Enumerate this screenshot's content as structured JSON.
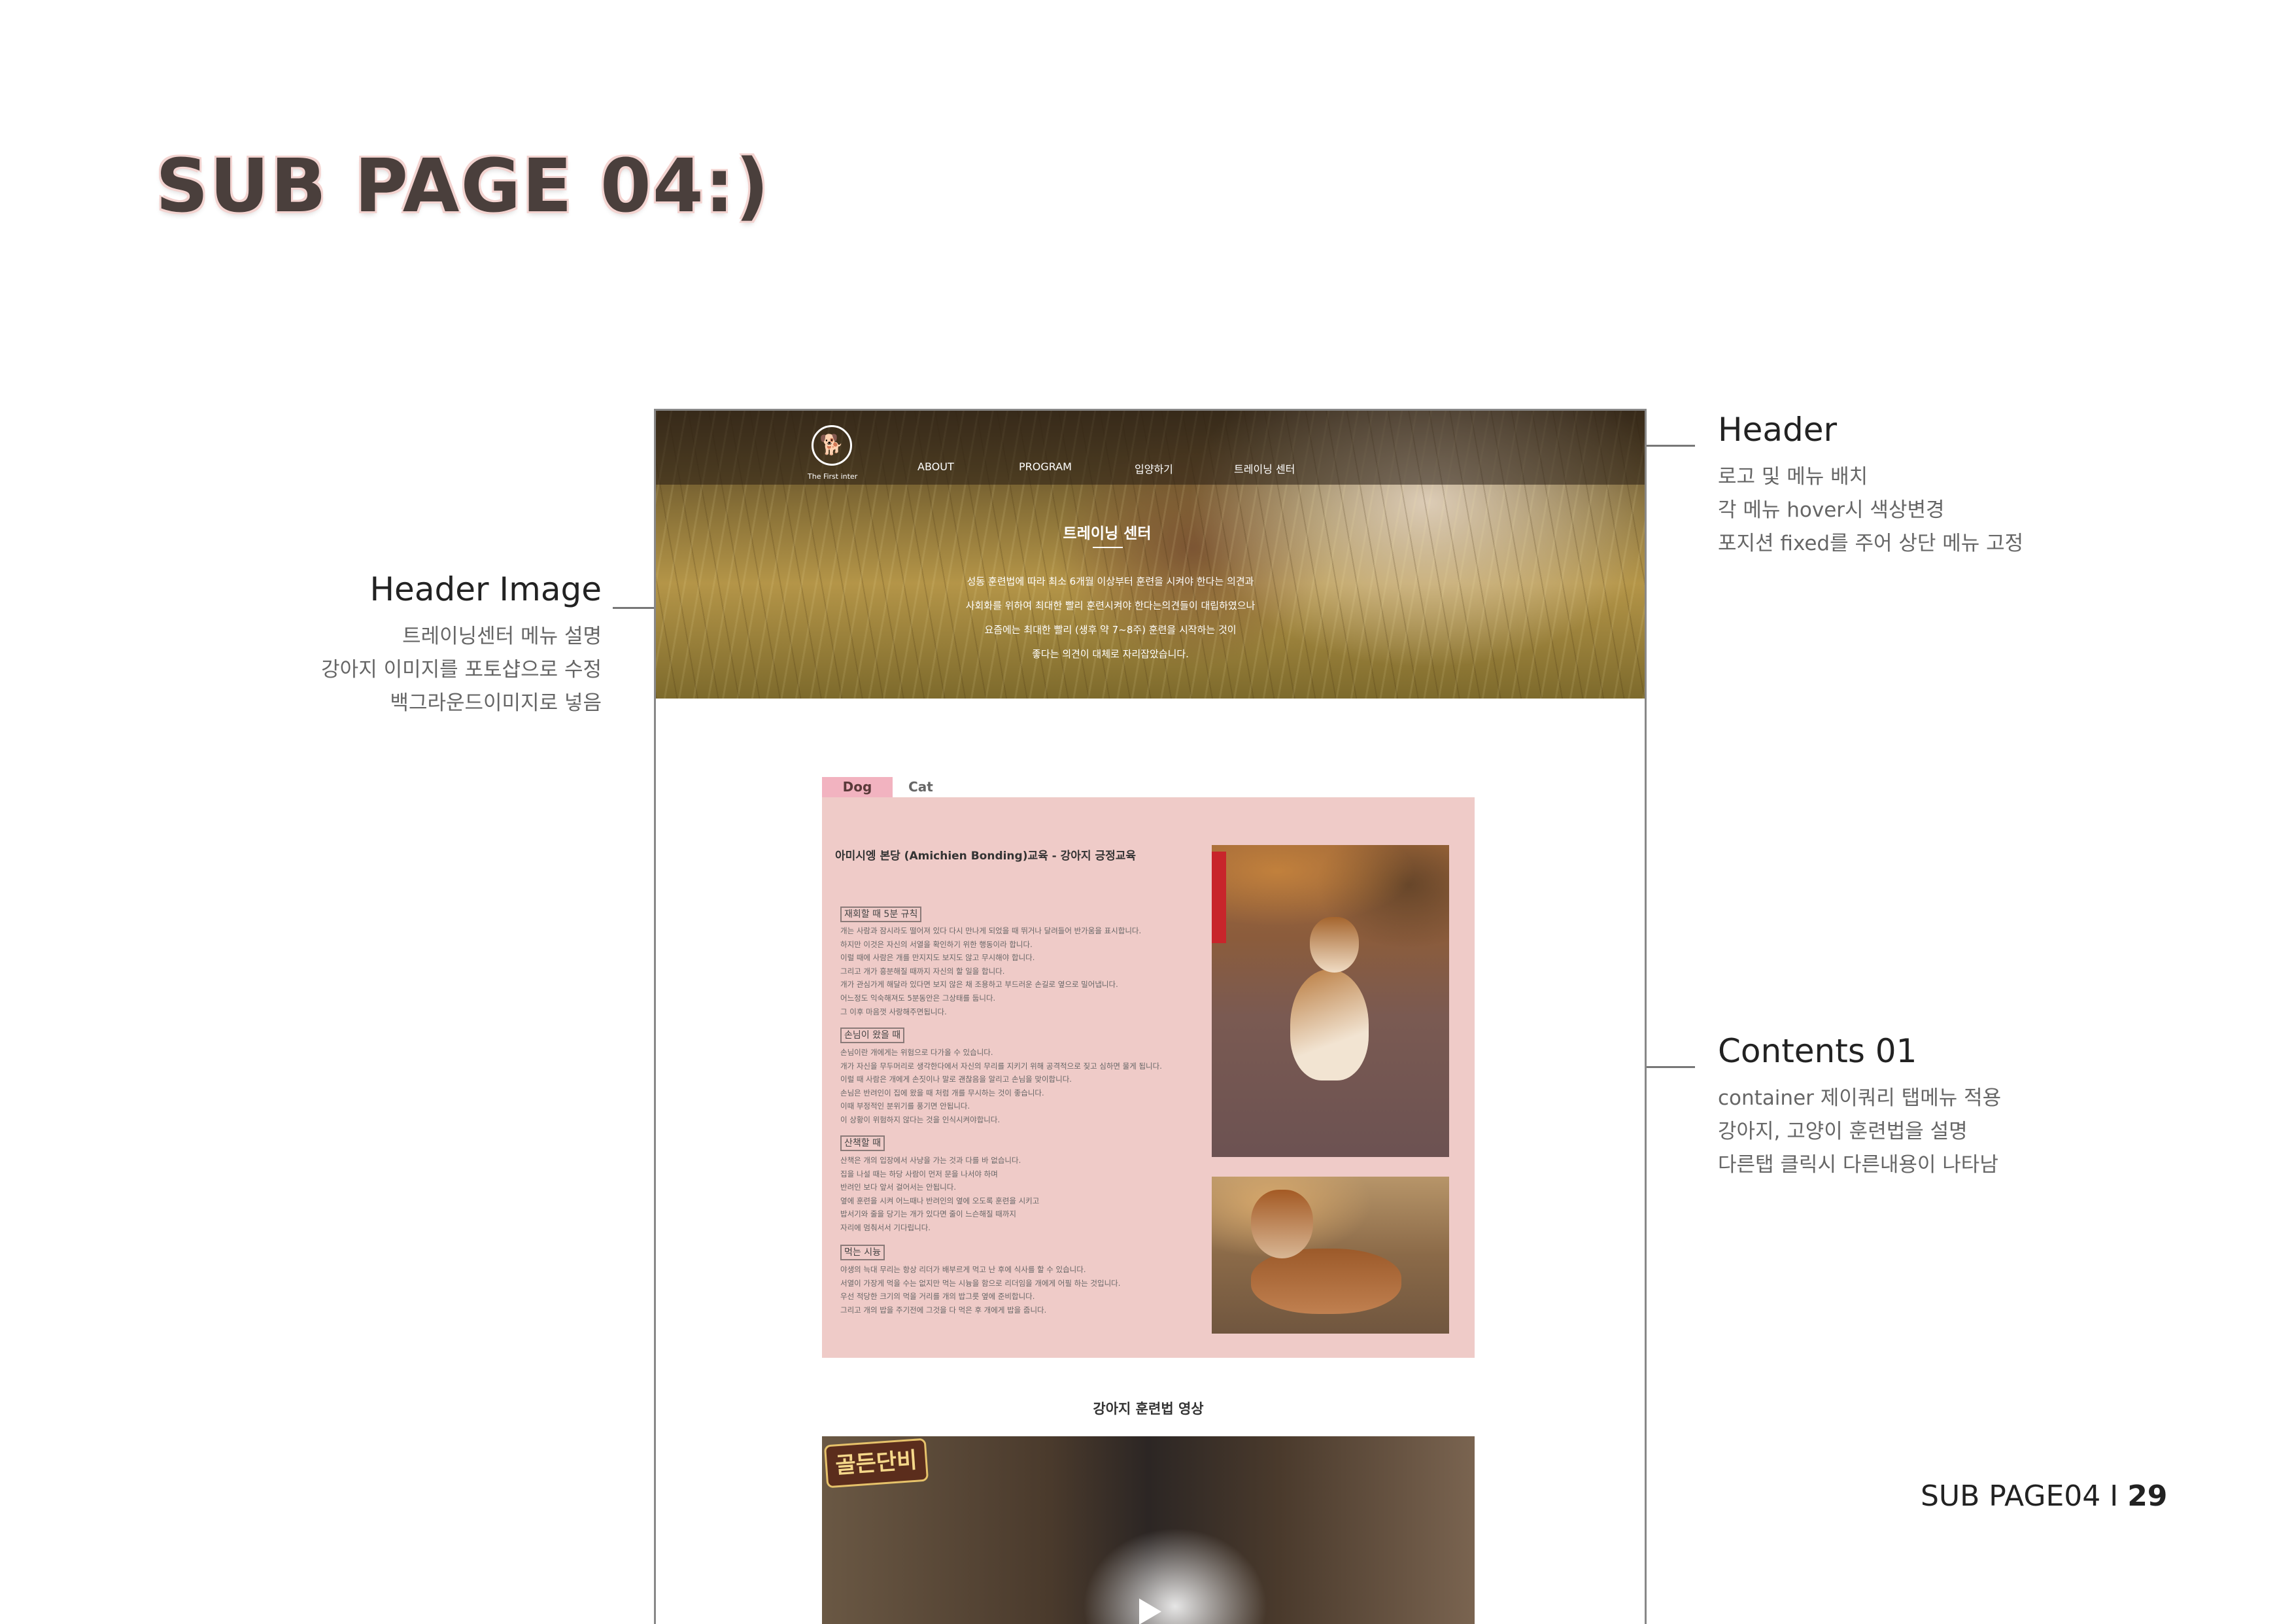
{
  "page_title": "SUB PAGE 04:)",
  "annotations": {
    "header": {
      "title": "Header",
      "lines": [
        "로고 및 메뉴 배치",
        "각 메뉴 hover시 색상변경",
        "포지션 fixed를 주어 상단 메뉴 고정"
      ]
    },
    "header_image": {
      "title": "Header Image",
      "lines": [
        "트레이닝센터 메뉴 설명",
        "강아지 이미지를 포토샵으로 수정",
        "백그라운드이미지로 넣음"
      ]
    },
    "contents01": {
      "title": "Contents 01",
      "lines": [
        "container 제이쿼리 탭메뉴 적용",
        "강아지, 고양이 훈련법을 설명",
        "다른탭 클릭시 다른내용이 나타남"
      ]
    }
  },
  "mockup": {
    "logo_text": "The First inter",
    "nav": [
      "ABOUT",
      "PROGRAM",
      "입양하기",
      "트레이닝 센터"
    ],
    "hero_title": "트레이닝 센터",
    "hero_lines": [
      "성동 훈련법에 따라 최소 6개월 이상부터 훈련을 시켜야 한다는 의견과",
      "사회화를 위하여 최대한 빨리 훈련시켜야 한다는의견들이 대립하였으나",
      "요즘에는 최대한 빨리 (생후 약 7~8주) 훈련을 시작하는 것이",
      "좋다는 의견이 대체로 자리잡았습니다."
    ],
    "tabs": [
      "Dog",
      "Cat"
    ],
    "section_title": "아미시엥 본당 (Amichien Bonding)교육 - 강아지 긍정교육",
    "subsections": [
      {
        "heading": "재회할 때 5분 규칙",
        "lines": [
          "개는 사람과 잠시라도 떨어져 있다 다시 만나게 되었을 때 뛰거나 달려들어 반가움을 표시합니다.",
          "하지만 이것은 자신의 서열을 확인하기 위한 행동이라 합니다.",
          "이럴 때에 사람은 개를 만지지도 보지도 않고 무시해야 합니다.",
          "그리고 개가 흥분해질 때까지 자신의 할 일을 합니다.",
          "개가 관심가게 해달라 있다면 보지 않은 채 조용하고 부드러운 손길로 옆으로 밀어냅니다.",
          "어느정도 익숙해져도 5분동안은 그상태를 둡니다.",
          "그 이후 마음껏 사랑해주면됩니다."
        ]
      },
      {
        "heading": "손님이 왔을 때",
        "lines": [
          "손님이란 개에게는 위험으로 다가올 수 있습니다.",
          "개가 자신을 무두머리로 생각한다에서 자신의 무리를 지키기 위해 공격적으로 짖고 심하면 물게 됩니다.",
          "이럴 때 사람은 개에게 손짓이나 말로 괜찮음을 알리고 손님을 맞이합니다.",
          "손님은 반려인이 집에 왔을 때 처럼 개를 무시하는 것이 좋습니다.",
          "이때 부정적인 분위기를 풍기면 안됩니다.",
          "이 상황이 위험하지 않다는 것을 인식시켜야합니다."
        ]
      },
      {
        "heading": "산책할 때",
        "lines": [
          "산책은 개의 입장에서 사냥을 가는 것과 다를 바 없습니다.",
          "집을 나설 때는 하당 사람이 먼저 문을 나서야 하며",
          "반려인 보다 앞서 걸어서는 안됩니다.",
          "옆에 훈련을 시켜 어느때나 반려인의 옆에 오도록 훈련을 시키고",
          "밥서기와 줄을 당기는 개가 있다면 줄이 느슨해질 때까지",
          "자리에 멈춰서서 기다립니다."
        ]
      },
      {
        "heading": "먹는 시늉",
        "lines": [
          "야생의 늑대 무리는 항상 리더가 배부르게 먹고 난 후에 식사를 할 수 있습니다.",
          "서열이 가장게 먹을 수는 없지만 먹는 시늉을 함으로 리더임을 개에게 어필 하는 것입니다.",
          "우선 적당한 크기의 먹을 거리를 개의 밥그릇 옆에 준비합니다.",
          "그리고 개의 밥을 주기전에 그것을 다 먹은 후 개에게 밥을 줍니다."
        ]
      }
    ],
    "video_title": "강아지 훈련법 영상",
    "video_badge": "골든단비"
  },
  "footer": {
    "label": "SUB PAGE04 I ",
    "page_number": "29"
  }
}
